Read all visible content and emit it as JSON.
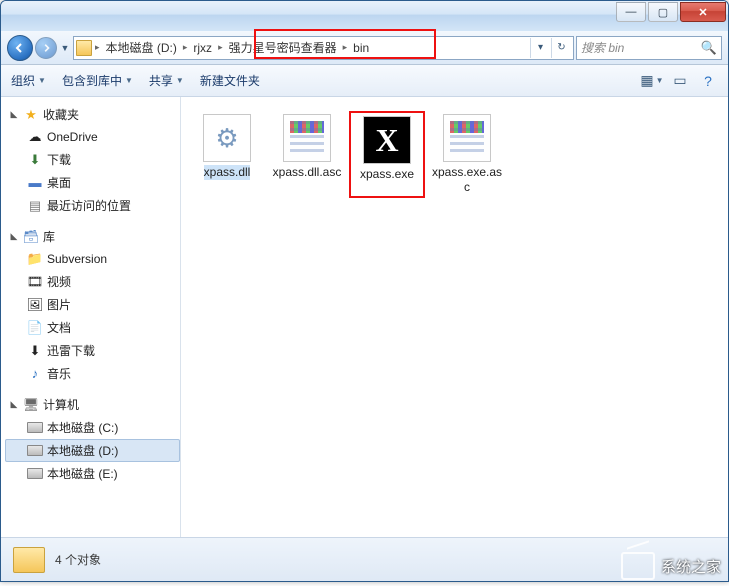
{
  "window_controls": {
    "min": "—",
    "max": "▢",
    "close": "✕"
  },
  "breadcrumb": {
    "drive": "本地磁盘 (D:)",
    "folder1": "rjxz",
    "folder2": "强力星号密码查看器",
    "folder3": "bin"
  },
  "search": {
    "placeholder": "搜索 bin"
  },
  "toolbar": {
    "organize": "组织",
    "include": "包含到库中",
    "share": "共享",
    "newfolder": "新建文件夹"
  },
  "sidebar": {
    "favorites": {
      "label": "收藏夹",
      "items": [
        "OneDrive",
        "下载",
        "桌面",
        "最近访问的位置"
      ]
    },
    "libraries": {
      "label": "库",
      "items": [
        "Subversion",
        "视频",
        "图片",
        "文档",
        "迅雷下载",
        "音乐"
      ]
    },
    "computer": {
      "label": "计算机",
      "items": [
        "本地磁盘 (C:)",
        "本地磁盘 (D:)",
        "本地磁盘 (E:)"
      ]
    }
  },
  "files": [
    {
      "name": "xpass.dll",
      "kind": "dll"
    },
    {
      "name": "xpass.dll.asc",
      "kind": "asc"
    },
    {
      "name": "xpass.exe",
      "kind": "exe"
    },
    {
      "name": "xpass.exe.asc",
      "kind": "asc"
    }
  ],
  "status": {
    "text": "4 个对象"
  },
  "watermark": {
    "text": "系统之家"
  }
}
